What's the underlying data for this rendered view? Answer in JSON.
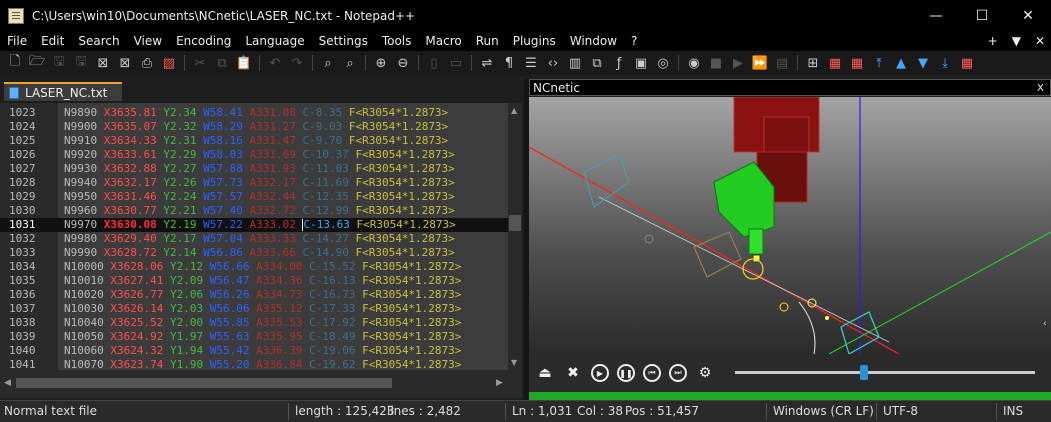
{
  "window": {
    "title": "C:\\Users\\win10\\Documents\\NCnetic\\LASER_NC.txt - Notepad++",
    "minimize": "—",
    "maximize": "☐",
    "close": "✕"
  },
  "menu": {
    "items": [
      "File",
      "Edit",
      "Search",
      "View",
      "Encoding",
      "Language",
      "Settings",
      "Tools",
      "Macro",
      "Run",
      "Plugins",
      "Window",
      "?"
    ],
    "right": {
      "add": "+",
      "dropdown": "▼",
      "close": "✕"
    }
  },
  "tab": {
    "label": "LASER_NC.txt"
  },
  "editor": {
    "lines": [
      {
        "num": "1023",
        "n": "N9890",
        "x": "X3635.81",
        "y": "Y2.34",
        "w": "W58.41",
        "a": "A331.08",
        "c": "C-8.35",
        "f": "F<R3054*1.2873>"
      },
      {
        "num": "1024",
        "n": "N9900",
        "x": "X3635.07",
        "y": "Y2.32",
        "w": "W58.29",
        "a": "A331.27",
        "c": "C-9.03",
        "f": "F<R3054*1.2873>"
      },
      {
        "num": "1025",
        "n": "N9910",
        "x": "X3634.33",
        "y": "Y2.31",
        "w": "W58.16",
        "a": "A331.47",
        "c": "C-9.70",
        "f": "F<R3054*1.2873>"
      },
      {
        "num": "1026",
        "n": "N9920",
        "x": "X3633.61",
        "y": "Y2.29",
        "w": "W58.03",
        "a": "A331.69",
        "c": "C-10.37",
        "f": "F<R3054*1.2873>"
      },
      {
        "num": "1027",
        "n": "N9930",
        "x": "X3632.88",
        "y": "Y2.27",
        "w": "W57.88",
        "a": "A331.93",
        "c": "C-11.03",
        "f": "F<R3054*1.2873>"
      },
      {
        "num": "1028",
        "n": "N9940",
        "x": "X3632.17",
        "y": "Y2.26",
        "w": "W57.73",
        "a": "A332.17",
        "c": "C-11.69",
        "f": "F<R3054*1.2873>"
      },
      {
        "num": "1029",
        "n": "N9950",
        "x": "X3631.46",
        "y": "Y2.24",
        "w": "W57.57",
        "a": "A332.44",
        "c": "C-12.35",
        "f": "F<R3054*1.2873>"
      },
      {
        "num": "1030",
        "n": "N9960",
        "x": "X3630.77",
        "y": "Y2.21",
        "w": "W57.40",
        "a": "A332.72",
        "c": "C-12.99",
        "f": "F<R3054*1.2873>"
      },
      {
        "num": "1031",
        "n": "N9970",
        "x": "X3630.08",
        "y": "Y2.19",
        "w": "W57.22",
        "a": "A333.02",
        "c": "C-13.63",
        "f": "F<R3054*1.2873>",
        "current": true
      },
      {
        "num": "1032",
        "n": "N9980",
        "x": "X3629.40",
        "y": "Y2.17",
        "w": "W57.04",
        "a": "A333.33",
        "c": "C-14.27",
        "f": "F<R3054*1.2873>"
      },
      {
        "num": "1033",
        "n": "N9990",
        "x": "X3628.72",
        "y": "Y2.14",
        "w": "W56.86",
        "a": "A333.66",
        "c": "C-14.90",
        "f": "F<R3054*1.2873>"
      },
      {
        "num": "1034",
        "n": "N10000",
        "x": "X3628.06",
        "y": "Y2.12",
        "w": "W56.66",
        "a": "A334.00",
        "c": "C-15.52",
        "f": "F<R3054*1.2872>"
      },
      {
        "num": "1035",
        "n": "N10010",
        "x": "X3627.41",
        "y": "Y2.09",
        "w": "W56.47",
        "a": "A334.36",
        "c": "C-16.13",
        "f": "F<R3054*1.2873>"
      },
      {
        "num": "1036",
        "n": "N10020",
        "x": "X3626.77",
        "y": "Y2.06",
        "w": "W56.26",
        "a": "A334.73",
        "c": "C-16.73",
        "f": "F<R3054*1.2873>"
      },
      {
        "num": "1037",
        "n": "N10030",
        "x": "X3626.14",
        "y": "Y2.03",
        "w": "W56.06",
        "a": "A335.12",
        "c": "C-17.33",
        "f": "F<R3054*1.2873>"
      },
      {
        "num": "1038",
        "n": "N10040",
        "x": "X3625.52",
        "y": "Y2.00",
        "w": "W55.85",
        "a": "A335.53",
        "c": "C-17.92",
        "f": "F<R3054*1.2873>"
      },
      {
        "num": "1039",
        "n": "N10050",
        "x": "X3624.92",
        "y": "Y1.97",
        "w": "W55.63",
        "a": "A335.95",
        "c": "C-18.49",
        "f": "F<R3054*1.2873>"
      },
      {
        "num": "1040",
        "n": "N10060",
        "x": "X3624.32",
        "y": "Y1.94",
        "w": "W55.42",
        "a": "A336.39",
        "c": "C-19.06",
        "f": "F<R3054*1.2873>"
      },
      {
        "num": "1041",
        "n": "N10070",
        "x": "X3623.74",
        "y": "Y1.90",
        "w": "W55.20",
        "a": "A336.84",
        "c": "C-19.62",
        "f": "F<R3054*1.2873>"
      }
    ]
  },
  "panel": {
    "title": "NCnetic",
    "close": "x",
    "slider_position": 0.43,
    "controls": [
      "eject-icon",
      "stop-icon",
      "play-icon",
      "pause-icon",
      "skip-back-icon",
      "skip-forward-icon",
      "settings-icon"
    ]
  },
  "status": {
    "file_type": "Normal text file",
    "length": "length : 125,423",
    "lines": "lines : 2,482",
    "ln": "Ln : 1,031",
    "col": "Col : 38",
    "pos": "Pos : 51,457",
    "eol": "Windows (CR LF)",
    "encoding": "UTF-8",
    "mode": "INS"
  },
  "colors": {
    "accent_tab": "#f0a030",
    "progress": "#1faa2a",
    "x_axis": "#ff5050",
    "y_axis": "#44bb44",
    "w_axis": "#3060ff"
  }
}
